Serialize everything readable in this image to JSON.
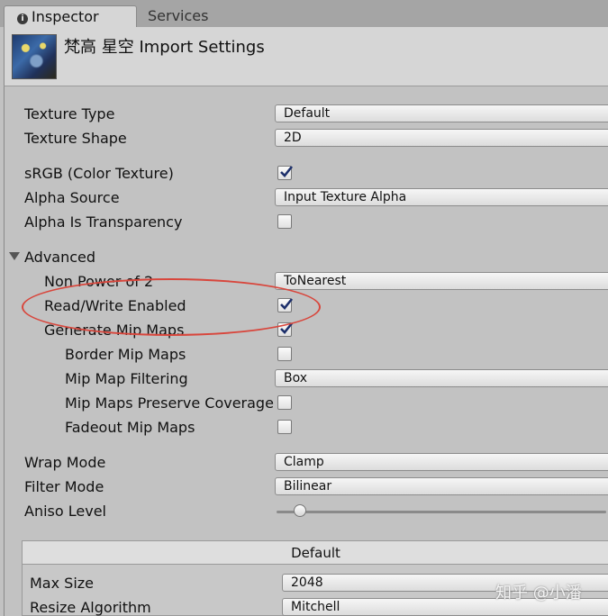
{
  "tabs": {
    "inspector": "Inspector",
    "services": "Services"
  },
  "header": {
    "title": "梵高 星空 Import Settings",
    "thumbnail_icon": "starry-night-thumbnail"
  },
  "fields": {
    "texture_type": {
      "label": "Texture Type",
      "value": "Default"
    },
    "texture_shape": {
      "label": "Texture Shape",
      "value": "2D"
    },
    "srgb": {
      "label": "sRGB (Color Texture)",
      "checked": true
    },
    "alpha_source": {
      "label": "Alpha Source",
      "value": "Input Texture Alpha"
    },
    "alpha_is_transparency": {
      "label": "Alpha Is Transparency",
      "checked": false
    },
    "advanced": {
      "label": "Advanced"
    },
    "non_power_of_2": {
      "label": "Non Power of 2",
      "value": "ToNearest"
    },
    "read_write": {
      "label": "Read/Write Enabled",
      "checked": true
    },
    "generate_mips": {
      "label": "Generate Mip Maps",
      "checked": true
    },
    "border_mips": {
      "label": "Border Mip Maps",
      "checked": false
    },
    "mip_filtering": {
      "label": "Mip Map Filtering",
      "value": "Box"
    },
    "mip_preserve": {
      "label": "Mip Maps Preserve Coverage",
      "checked": false
    },
    "fadeout_mips": {
      "label": "Fadeout Mip Maps",
      "checked": false
    },
    "wrap_mode": {
      "label": "Wrap Mode",
      "value": "Clamp"
    },
    "filter_mode": {
      "label": "Filter Mode",
      "value": "Bilinear"
    },
    "aniso_level": {
      "label": "Aniso Level",
      "value": 1,
      "min": 0,
      "max": 16
    }
  },
  "platform": {
    "header": "Default",
    "max_size": {
      "label": "Max Size",
      "value": "2048"
    },
    "resize_algorithm": {
      "label": "Resize Algorithm",
      "value": "Mitchell"
    }
  },
  "watermark": "知乎 @小潘",
  "colors": {
    "annotation": "#d8463c",
    "check": "#1c2f6b"
  }
}
